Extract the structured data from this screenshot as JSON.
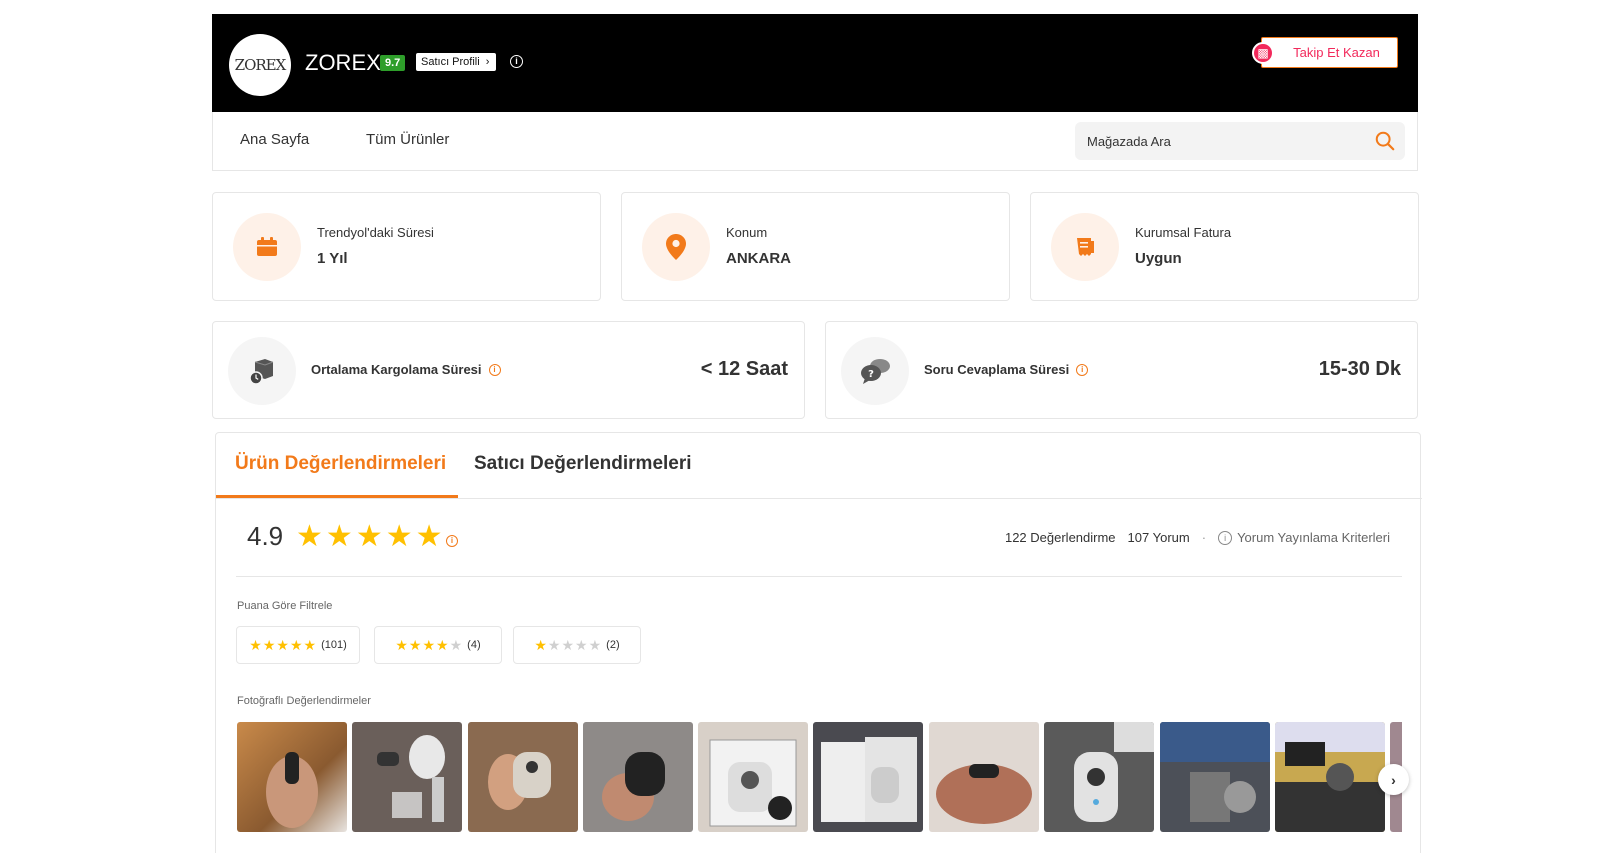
{
  "header": {
    "logo_text": "ZOREX",
    "store_name": "ZOREX",
    "score": "9.7",
    "seller_profile_label": "Satıcı Profili",
    "follow_label": "Takip Et Kazan"
  },
  "nav": {
    "items": [
      {
        "label": "Ana Sayfa"
      },
      {
        "label": "Tüm Ürünler"
      }
    ],
    "search_placeholder": "Mağazada Ara"
  },
  "info_cards": [
    {
      "label": "Trendyol'daki Süresi",
      "value": "1 Yıl",
      "icon": "calendar-icon"
    },
    {
      "label": "Konum",
      "value": "ANKARA",
      "icon": "location-pin-icon"
    },
    {
      "label": "Kurumsal Fatura",
      "value": "Uygun",
      "icon": "invoice-icon"
    }
  ],
  "metrics": [
    {
      "label": "Ortalama Kargolama Süresi",
      "value": "< 12 Saat",
      "icon": "shipping-box-icon"
    },
    {
      "label": "Soru Cevaplama Süresi",
      "value": "15-30 Dk",
      "icon": "chat-bubbles-icon"
    }
  ],
  "reviews": {
    "tabs": [
      {
        "label": "Ürün Değerlendirmeleri",
        "active": true
      },
      {
        "label": "Satıcı Değerlendirmeleri",
        "active": false
      }
    ],
    "rating": "4.9",
    "rating_count": "122 Değerlendirme",
    "comment_count": "107 Yorum",
    "criteria_label": "Yorum Yayınlama Kriterleri",
    "filter_title": "Puana Göre Filtrele",
    "filters": [
      {
        "stars": 5,
        "count": "(101)"
      },
      {
        "stars": 4,
        "count": "(4)"
      },
      {
        "stars": 1,
        "count": "(2)"
      }
    ],
    "photo_title": "Fotoğraflı Değerlendirmeler"
  },
  "colors": {
    "accent": "#f27a1a",
    "star": "#ffc000",
    "score_badge": "#2e9e2a",
    "follow_text": "#f2295b"
  }
}
